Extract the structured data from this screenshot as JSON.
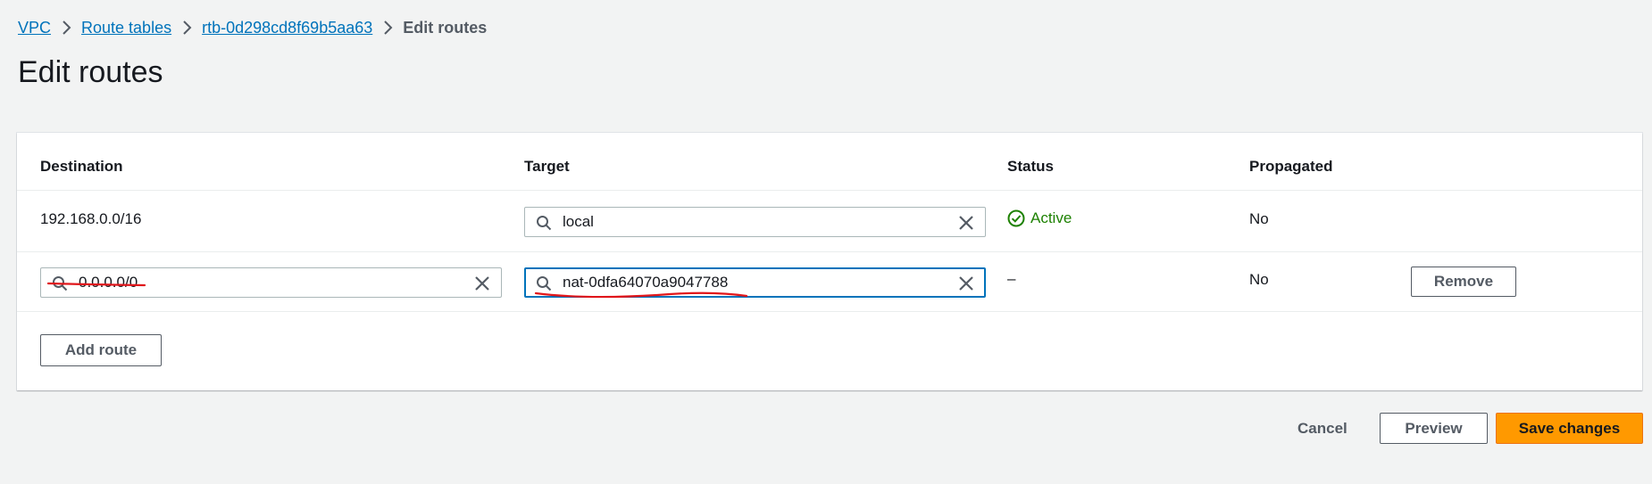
{
  "breadcrumb": {
    "items": [
      {
        "label": "VPC"
      },
      {
        "label": "Route tables"
      },
      {
        "label": "rtb-0d298cd8f69b5aa63"
      }
    ],
    "current": "Edit routes"
  },
  "page": {
    "title": "Edit routes"
  },
  "table": {
    "headers": {
      "destination": "Destination",
      "target": "Target",
      "status": "Status",
      "propagated": "Propagated"
    },
    "rows": [
      {
        "destination": "192.168.0.0/16",
        "target": "local",
        "status": "Active",
        "propagated": "No"
      },
      {
        "destination": "0.0.0.0/0",
        "target": "nat-0dfa64070a9047788",
        "status": "–",
        "propagated": "No",
        "remove_label": "Remove"
      }
    ],
    "add_route_label": "Add route"
  },
  "footer": {
    "cancel_label": "Cancel",
    "preview_label": "Preview",
    "save_label": "Save changes"
  },
  "colors": {
    "link": "#0073bb",
    "active": "#1d8102",
    "primary": "#ff9900",
    "focus": "#0073bb",
    "annotation": "#e0161b"
  },
  "icons": {
    "breadcrumb_separator": "chevron-right-icon",
    "search": "search-icon",
    "clear": "close-icon",
    "status": "check-circle-icon"
  }
}
